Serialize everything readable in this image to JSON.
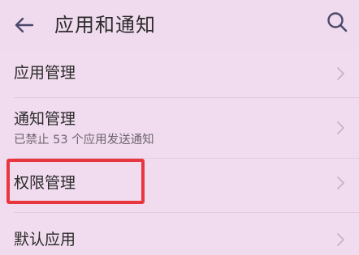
{
  "header": {
    "title": "应用和通知",
    "back_icon": "arrow-left-icon",
    "search_icon": "search-icon"
  },
  "items": [
    {
      "title": "应用管理",
      "subtitle": ""
    },
    {
      "title": "通知管理",
      "subtitle": "已禁止 53 个应用发送通知"
    },
    {
      "title": "权限管理",
      "subtitle": ""
    },
    {
      "title": "默认应用",
      "subtitle": ""
    }
  ],
  "highlight": {
    "color": "#e8363f",
    "target": "权限管理"
  },
  "colors": {
    "background": "#f1dcef",
    "text": "#2a2a2a",
    "subtext": "#6e6470",
    "accent_icon": "#4a4a6a"
  }
}
